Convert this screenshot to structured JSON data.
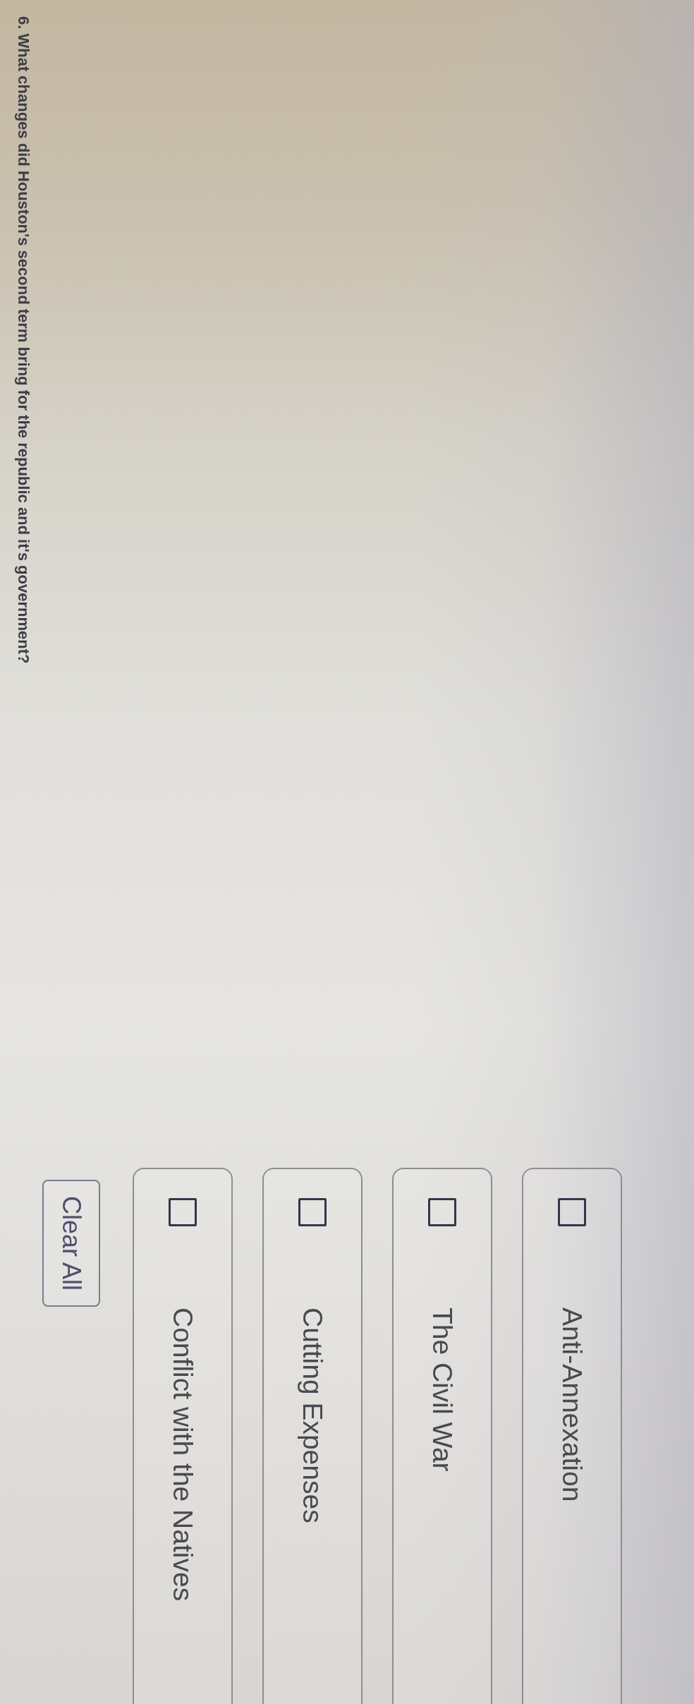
{
  "question": {
    "text": "6. What changes did Houston's second term bring for the republic and it's government?"
  },
  "options": [
    {
      "label": "Anti-Annexation",
      "checked": false
    },
    {
      "label": "The Civil War",
      "checked": false
    },
    {
      "label": "Cutting Expenses",
      "checked": false
    },
    {
      "label": "Conflict with the Natives",
      "checked": false
    }
  ],
  "clear_button": {
    "label": "Clear All"
  }
}
